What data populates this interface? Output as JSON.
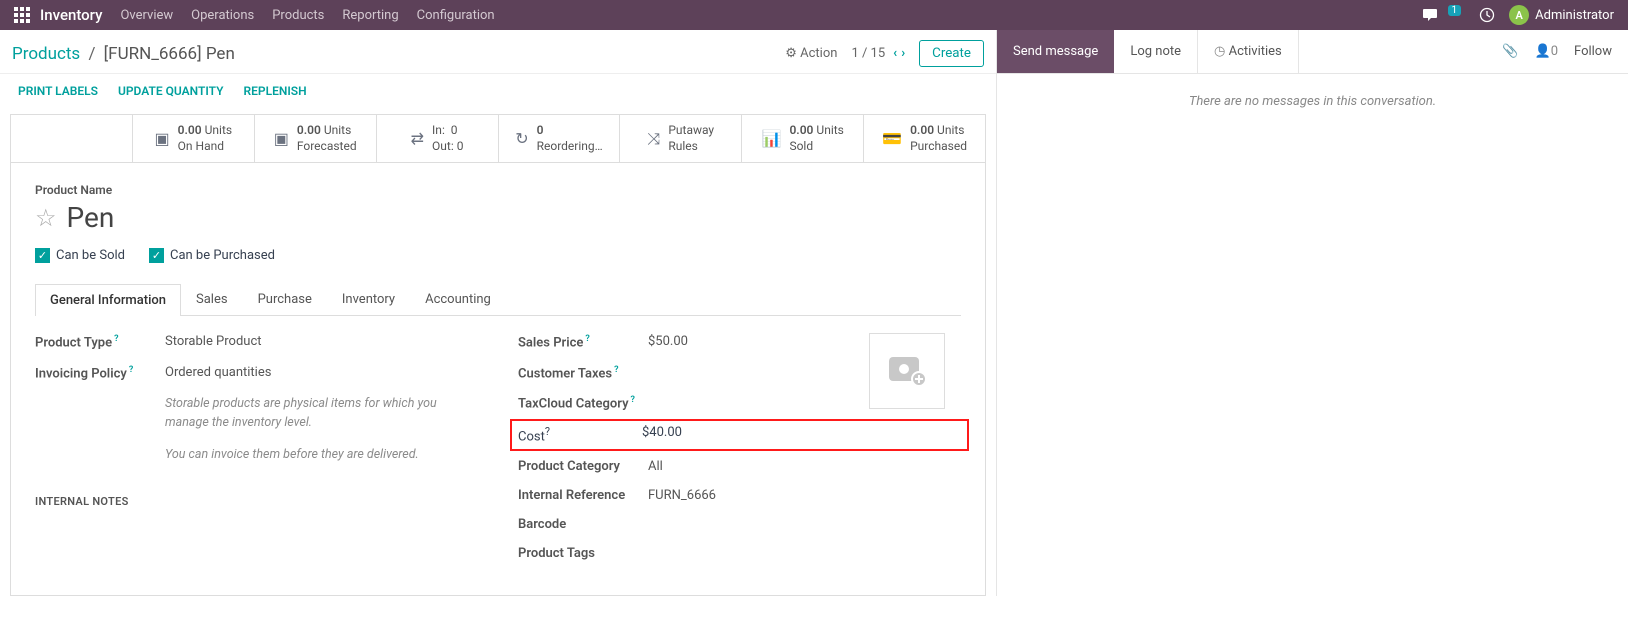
{
  "topbar": {
    "brand": "Inventory",
    "nav": [
      "Overview",
      "Operations",
      "Products",
      "Reporting",
      "Configuration"
    ],
    "msg_count": "1",
    "user": "Administrator",
    "user_initial": "A"
  },
  "crumb": {
    "parent": "Products",
    "current": "[FURN_6666] Pen",
    "action": "Action",
    "pager": "1 / 15",
    "create": "Create"
  },
  "actions": {
    "print": "PRINT LABELS",
    "update": "UPDATE QUANTITY",
    "replenish": "REPLENISH"
  },
  "stats": {
    "onhand_v": "0.00",
    "onhand_u": "Units",
    "onhand_l": "On Hand",
    "forecast_v": "0.00",
    "forecast_u": "Units",
    "forecast_l": "Forecasted",
    "in_l": "In:",
    "in_v": "0",
    "out_l": "Out:",
    "out_v": "0",
    "reorder_v": "0",
    "reorder_l": "Reordering…",
    "putaway_l1": "Putaway",
    "putaway_l2": "Rules",
    "sold_v": "0.00",
    "sold_u": "Units",
    "sold_l": "Sold",
    "purch_v": "0.00",
    "purch_u": "Units",
    "purch_l": "Purchased"
  },
  "product": {
    "name_label": "Product Name",
    "name": "Pen",
    "can_sold": "Can be Sold",
    "can_purch": "Can be Purchased"
  },
  "tabs": [
    "General Information",
    "Sales",
    "Purchase",
    "Inventory",
    "Accounting"
  ],
  "left_fields": {
    "ptype_l": "Product Type",
    "ptype_v": "Storable Product",
    "inv_l": "Invoicing Policy",
    "inv_v": "Ordered quantities",
    "hint1": "Storable products are physical items for which you manage the inventory level.",
    "hint2": "You can invoice them before they are delivered."
  },
  "right_fields": {
    "sp_l": "Sales Price",
    "sp_v": "$50.00",
    "ct_l": "Customer Taxes",
    "tc_l": "TaxCloud Category",
    "cost_l": "Cost",
    "cost_v": "$40.00",
    "pc_l": "Product Category",
    "pc_v": "All",
    "ir_l": "Internal Reference",
    "ir_v": "FURN_6666",
    "bc_l": "Barcode",
    "pt_l": "Product Tags"
  },
  "internal_notes": "INTERNAL NOTES",
  "messaging": {
    "send": "Send message",
    "log": "Log note",
    "act": "Activities",
    "follow_count": "0",
    "follow": "Follow",
    "empty": "There are no messages in this conversation."
  }
}
